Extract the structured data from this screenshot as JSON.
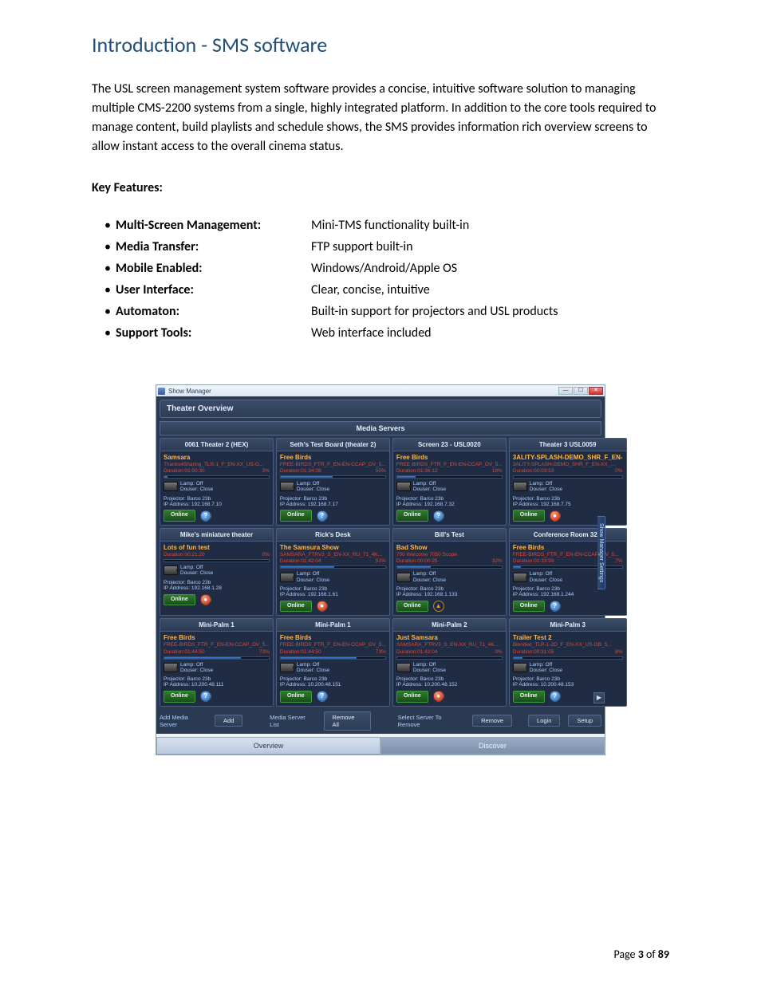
{
  "heading": "Introduction - SMS software",
  "intro": "The USL screen management system software provides a concise, intuitive software solution to managing multiple CMS-2200 systems from a single, highly integrated platform.  In addition to the core tools required to manage content, build playlists and schedule shows, the SMS provides information rich overview screens to allow instant access to the overall cinema status.",
  "kf_title": "Key Features:",
  "features": [
    {
      "label": "Multi-Screen Management:",
      "val": "Mini-TMS functionality built-in"
    },
    {
      "label": "Media Transfer:",
      "val": "FTP support built-in"
    },
    {
      "label": "Mobile Enabled:",
      "val": "Windows/Android/Apple OS"
    },
    {
      "label": "User Interface:",
      "val": "Clear, concise, intuitive"
    },
    {
      "label": "Automaton:",
      "val": "Built-in support for projectors and USL products"
    },
    {
      "label": "Support Tools:",
      "val": "Web interface included"
    }
  ],
  "footer": {
    "p1": "Page ",
    "n1": "3",
    "mid": " of ",
    "n2": "89"
  },
  "window": {
    "title": "Show Manager",
    "theater_overview": "Theater Overview",
    "media_servers": "Media Servers",
    "side_handle": "Show Manager Settings",
    "bottom": {
      "add_label": "Add Media Server",
      "add_btn": "Add",
      "list_label": "Media Server List",
      "remove_all": "Remove All",
      "sel_label": "Select Server To Remove",
      "remove": "Remove",
      "login": "Login",
      "setup": "Setup",
      "tab_overview": "Overview",
      "tab_discover": "Discover"
    },
    "lamp": "Lamp: Off",
    "douser": "Douser: Close",
    "projector": "Projector: Barco 23b",
    "online": "Online",
    "tiles": [
      {
        "head": "0061 Theater 2 (HEX)",
        "show": "Samsara",
        "meta": "Thanks4Sharing_TLR-1_F_EN-XX_US-G...",
        "dur": "Duration:01:50:30",
        "pct": "3%",
        "fill": 3,
        "ip": "IP Address: 192.168.7.10",
        "ind": "blue"
      },
      {
        "head": "Seth's Test Board (theater 2)",
        "show": "Free Birds",
        "meta": "FREE-BIRDS_FTR_F_EN-EN-CCAP_OV_5...",
        "dur": "Duration:01:34:08",
        "pct": "50%",
        "fill": 50,
        "ip": "IP Address: 192.168.7.17",
        "ind": "blue"
      },
      {
        "head": "Screen 23 - USL0020",
        "show": "Free Birds",
        "meta": "FREE-BIRDS_FTR_F_EN-EN-CCAP_OV_5...",
        "dur": "Duration:01:36:12",
        "pct": "18%",
        "fill": 18,
        "ip": "IP Address: 192.168.7.32",
        "ind": "blue"
      },
      {
        "head": "Theater 3 USL0059",
        "show": "3ALITY-SPLASH-DEMO_SHR_F_EN-",
        "meta": "3ALITY-SPLASH-DEMO_SHR_F_EN-XX_...",
        "dur": "Duration:00:03:53",
        "pct": "0%",
        "fill": 0,
        "ip": "IP Address: 192.168.7.75",
        "ind": "red"
      },
      {
        "head": "Mike's miniature theater",
        "show": "Lots of fun test",
        "meta": "",
        "dur": "Duration:00:21:20",
        "pct": "0%",
        "fill": 0,
        "ip": "IP Address: 192.168.1.28",
        "ind": "red"
      },
      {
        "head": "Rick's Desk",
        "show": "The Samsura Show",
        "meta": "SAMSARA_FTRV3_S_EN-XX_RU_71_4K...",
        "dur": "Duration:01:42:04",
        "pct": "51%",
        "fill": 51,
        "ip": "IP Address: 192.168.1.61",
        "ind": "red"
      },
      {
        "head": "Bill's Test",
        "show": "Bad Show",
        "meta": "700 Welcome 7050 Scope",
        "dur": "Duration:00:00:25",
        "pct": "32%",
        "fill": 32,
        "ip": "IP Address: 192.168.1.133",
        "ind": "warn"
      },
      {
        "head": "Conference Room 32B",
        "show": "Free Birds",
        "meta": "FREE-BIRDS_FTR_F_EN-EN-CCAP_OV_5...",
        "dur": "Duration:01:33:59",
        "pct": "7%",
        "fill": 7,
        "ip": "IP Address: 192.168.1.244",
        "ind": "blue"
      },
      {
        "head": "Mini-Palm 1",
        "show": "Free Birds",
        "meta": "FREE-BIRDS_FTR_F_EN-EN-CCAP_OV_5...",
        "dur": "Duration:01:44:50",
        "pct": "73%",
        "fill": 73,
        "ip": "IP Address: 10.200.48.111",
        "ind": "blue"
      },
      {
        "head": "Mini-Palm 1",
        "show": "Free Birds",
        "meta": "FREE-BIRDS_FTR_F_EN-EN-CCAP_OV_5...",
        "dur": "Duration:01:44:50",
        "pct": "73%",
        "fill": 73,
        "ip": "IP Address: 10.200.48.151",
        "ind": "blue"
      },
      {
        "head": "Mini-Palm 2",
        "show": "Just Samsara",
        "meta": "SAMSARA_FTRV3_S_EN-XX_RU_71_4K...",
        "dur": "Duration:01:42:04",
        "pct": "0%",
        "fill": 0,
        "ip": "IP Address: 10.200.48.152",
        "ind": "red"
      },
      {
        "head": "Mini-Palm 3",
        "show": "Trailer Test 2",
        "meta": "Blended_TLR-1-2D_F_EN-XX_US-GB_5...",
        "dur": "Duration:00:31:05",
        "pct": "8%",
        "fill": 8,
        "ip": "IP Address: 10.200.48.153",
        "ind": "blue"
      }
    ]
  }
}
